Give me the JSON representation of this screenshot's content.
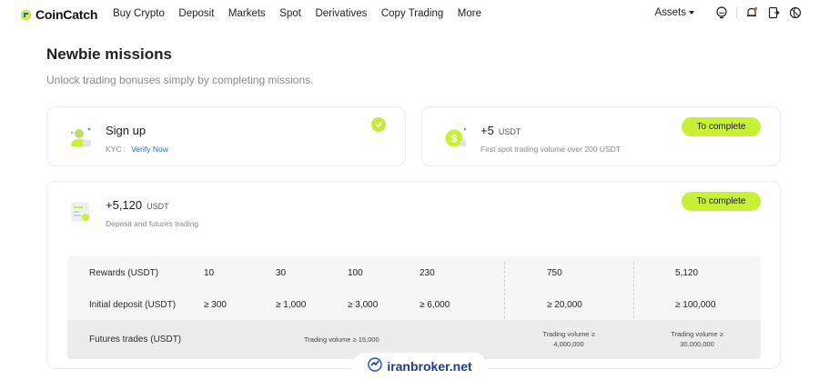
{
  "brand": {
    "name": "CoinCatch",
    "accent": "#c6f135"
  },
  "nav": {
    "links": [
      "Buy Crypto",
      "Deposit",
      "Markets",
      "Spot",
      "Derivatives",
      "Copy Trading",
      "More"
    ],
    "assets_label": "Assets",
    "icons": [
      "support-icon",
      "bell-icon",
      "download-icon",
      "globe-icon"
    ]
  },
  "page": {
    "title": "Newbie missions",
    "subtitle": "Unlock trading bonuses simply by completing missions."
  },
  "missions": [
    {
      "title": "Sign up",
      "desc_prefix": "KYC :",
      "desc_link": "Verify Now",
      "status": "completed"
    },
    {
      "title": "+5",
      "unit": "USDT",
      "desc": "First spot trading volume over 200 USDT",
      "button": "To complete"
    },
    {
      "title": "+5,120",
      "unit": "USDT",
      "desc": "Deposit and futures trading",
      "button": "To complete"
    }
  ],
  "table": {
    "rewards_label": "Rewards (USDT)",
    "rewards": [
      "10",
      "30",
      "100",
      "230",
      "750",
      "5,120"
    ],
    "deposit_label": "Initial deposit (USDT)",
    "deposits": [
      "≥ 300",
      "≥ 1,000",
      "≥ 3,000",
      "≥ 6,000",
      "≥ 20,000",
      "≥ 100,000"
    ],
    "futures_label": "Futures trades (USDT)",
    "futures": [
      "Trading volume ≥ 15,000",
      "Trading volume ≥",
      "4,000,000",
      "Trading volume ≥",
      "30,000,000"
    ]
  },
  "watermark": "iranbroker.net"
}
